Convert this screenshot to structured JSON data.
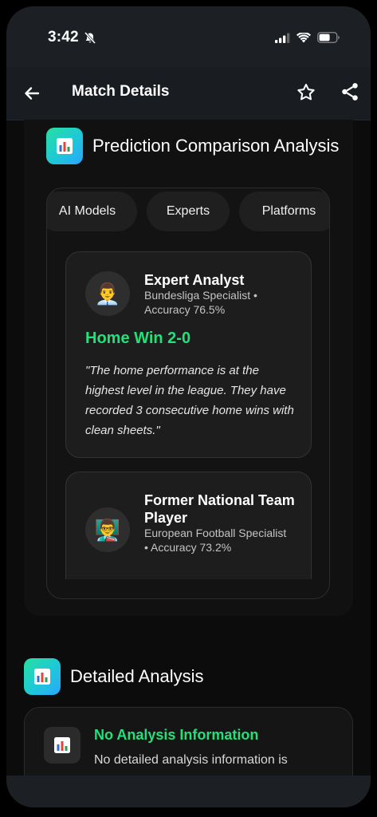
{
  "status_bar": {
    "time": "3:42",
    "icons": [
      "bell-slash-icon",
      "signal-icon",
      "wifi-icon",
      "battery-icon"
    ]
  },
  "app_bar": {
    "title": "Match Details",
    "icons": [
      "back-arrow-icon",
      "star-icon",
      "share-icon"
    ]
  },
  "comparison": {
    "title": "Prediction Comparison Analysis",
    "tabs": [
      "AI Models",
      "Experts",
      "Platforms"
    ],
    "cards": [
      {
        "avatar": "👨‍💼",
        "name": "Expert Analyst",
        "subtitle": "Bundesliga Specialist • Accuracy 76.5%",
        "prediction": "Home Win 2-0",
        "quote": "\"The home performance is at the highest level in the league. They have recorded 3 consecutive home wins with clean sheets.\""
      },
      {
        "avatar": "👨‍🏫",
        "name": "Former National Team Player",
        "subtitle": "European Football Specialist • Accuracy 73.2%"
      }
    ]
  },
  "detailed_analysis": {
    "title": "Detailed Analysis",
    "empty_title": "No Analysis Information",
    "empty_text": "No detailed analysis information is"
  },
  "colors": {
    "accent_green": "#22e07a",
    "badge_gradient_start": "#27e0a0",
    "badge_gradient_end": "#2aa5ff",
    "background": "#0c0c0c"
  }
}
